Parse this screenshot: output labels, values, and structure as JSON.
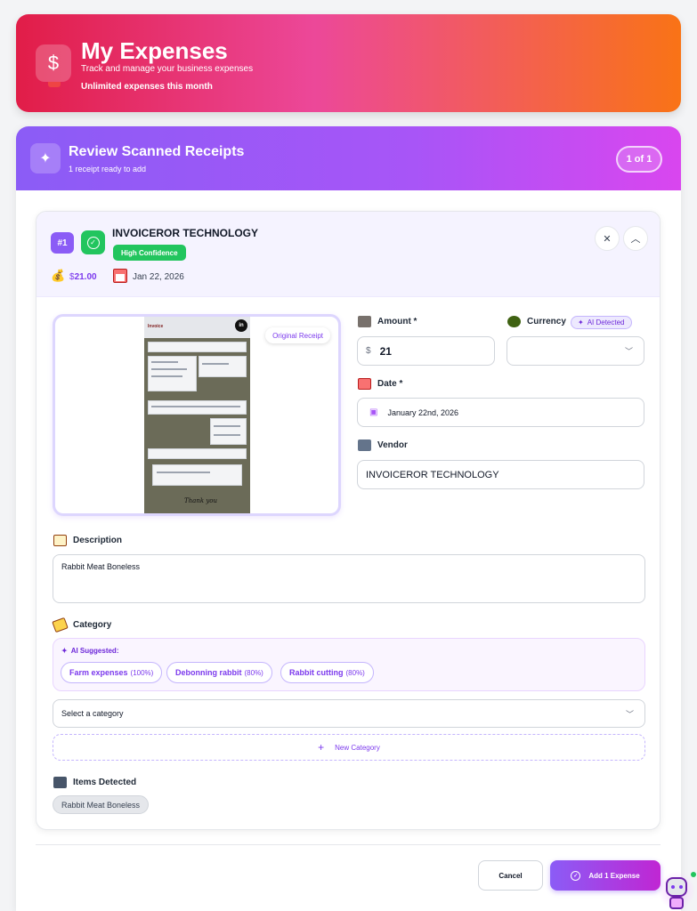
{
  "header": {
    "icon": "dollar-icon",
    "title": "My Expenses",
    "subtitle": "Track and manage your business expenses",
    "plan_note": "Unlimited expenses this month"
  },
  "review": {
    "icon": "sparkles-icon",
    "title": "Review Scanned Receipts",
    "subtitle": "1 receipt ready to add",
    "pager": "1 of 1"
  },
  "receipt": {
    "number": "#1",
    "vendor_title": "INVOICEROR TECHNOLOGY",
    "confidence": "High Confidence",
    "amount_currency_symbol": "$",
    "amount_display": "21.00",
    "date_display": "Jan 22, 2026",
    "original_tag": "Original Receipt",
    "preview": {
      "doc_heading": "Invoice",
      "doc_logo": "in",
      "doc_footer": "Thank you"
    }
  },
  "form": {
    "amount_label": "Amount *",
    "amount_prefix": "$",
    "amount_value": "21",
    "currency_label": "Currency",
    "ai_detected": "AI Detected",
    "currency_value": "",
    "date_label": "Date *",
    "date_value": "January 22nd, 2026",
    "vendor_label": "Vendor",
    "vendor_value": "INVOICEROR TECHNOLOGY",
    "description_label": "Description",
    "description_value": "Rabbit Meat Boneless",
    "category_label": "Category",
    "ai_suggested_label": "AI Suggested:",
    "suggestions": [
      {
        "name": "Farm expenses",
        "pct": "(100%)"
      },
      {
        "name": "Debonning rabbit",
        "pct": "(80%)"
      },
      {
        "name": "Rabbit cutting",
        "pct": "(80%)"
      }
    ],
    "category_placeholder": "Select a category",
    "new_category": "New Category",
    "items_label": "Items Detected",
    "items": [
      "Rabbit Meat Boneless"
    ]
  },
  "actions": {
    "cancel": "Cancel",
    "add": "Add 1 Expense"
  },
  "colors": {
    "brand_purple": "#8b5cf6",
    "hero_start": "#e11d48",
    "hero_end": "#f97316",
    "success": "#22c55e"
  }
}
